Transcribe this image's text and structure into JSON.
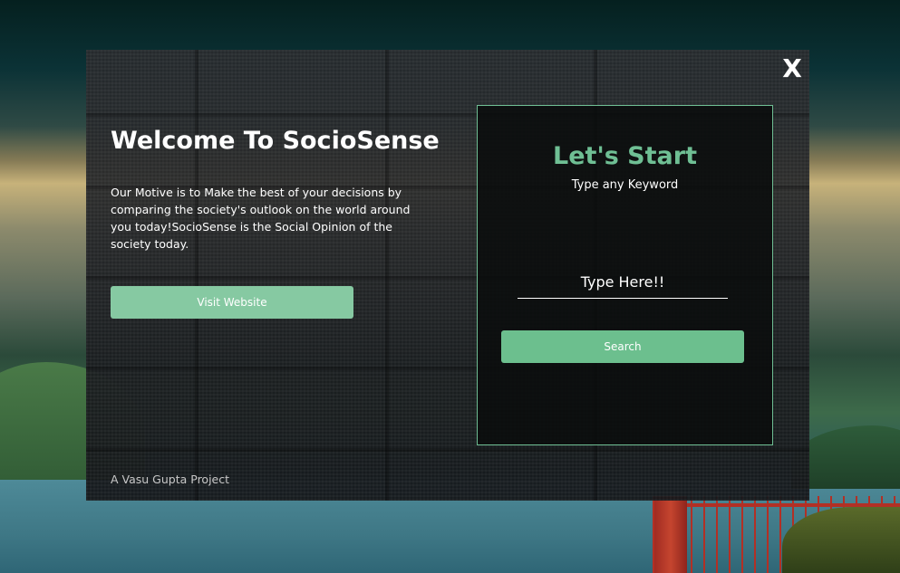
{
  "modal": {
    "close_label": "X",
    "title": "Welcome To SocioSense",
    "motive": "Our Motive is to Make the best of your decisions by comparing the society's outlook on the world around you today!SocioSense is the Social Opinion of the society today.",
    "visit_button": "Visit Website",
    "credit": "A Vasu Gupta Project"
  },
  "panel": {
    "title": "Let's Start",
    "subtitle": "Type any Keyword",
    "search_placeholder": "Type Here!!",
    "search_button": "Search"
  },
  "colors": {
    "accent": "#6fbf94",
    "visit_button": "#86c9a2",
    "search_button": "#6cbf8e"
  }
}
